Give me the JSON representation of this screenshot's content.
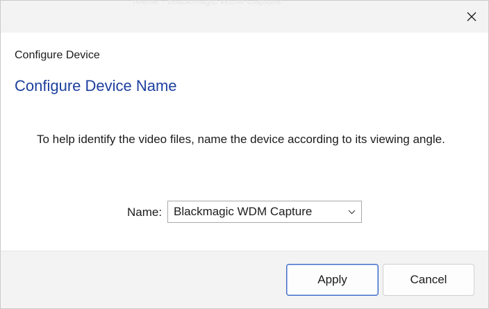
{
  "window": {
    "background_title": "Name - Blackmagic WDM Capture",
    "close_icon": "close-icon"
  },
  "dialog": {
    "caption": "Configure Device",
    "heading": "Configure Device Name",
    "description": "To help identify the video files, name the device according to its viewing angle.",
    "name_label": "Name:",
    "name_value": "Blackmagic WDM Capture",
    "dropdown_icon": "chevron-down-icon"
  },
  "footer": {
    "apply_label": "Apply",
    "cancel_label": "Cancel"
  },
  "colors": {
    "heading": "#1d3f9e",
    "primary_border": "#3f6bc9",
    "chrome": "#f3f3f3"
  }
}
